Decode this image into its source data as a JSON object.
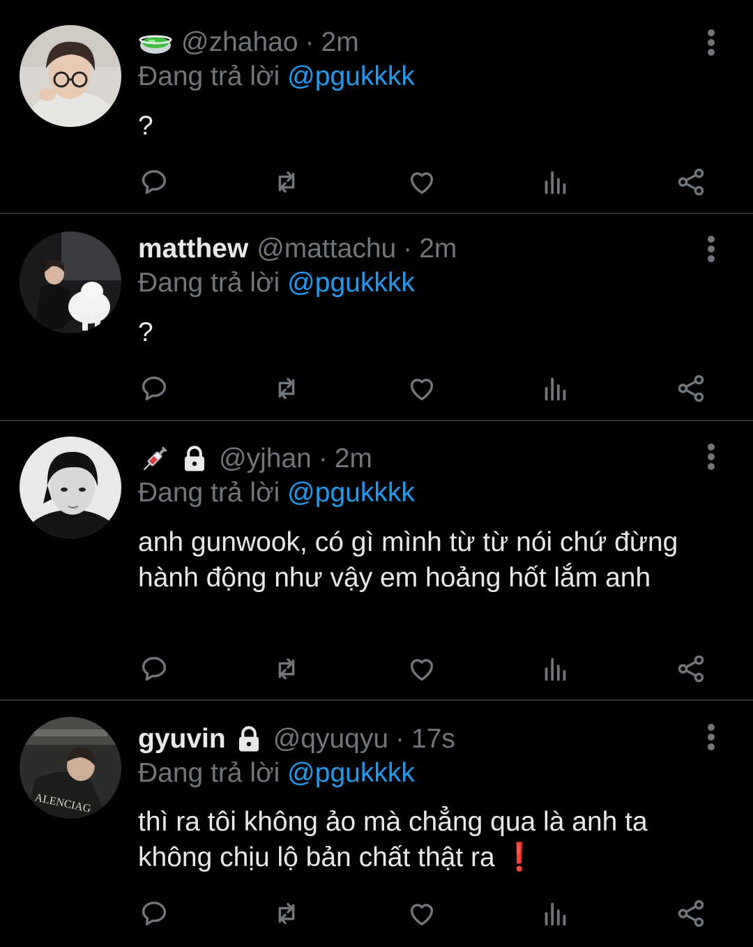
{
  "theme": {
    "background": "#000000",
    "text_primary": "#e7e9ea",
    "text_secondary": "#71767b",
    "accent": "#1d9bf0",
    "divider": "#2f3336"
  },
  "tweets": [
    {
      "display_name": "",
      "name_emoji": "green-bowl-emoji",
      "handle": "@zhahao",
      "separator": "·",
      "time": "2m",
      "reply_prefix": "Đang trả lời",
      "reply_to": "@pgukkkk",
      "text": "?"
    },
    {
      "display_name": "matthew",
      "handle": "@mattachu",
      "separator": "·",
      "time": "2m",
      "reply_prefix": "Đang trả lời",
      "reply_to": "@pgukkkk",
      "text": "?"
    },
    {
      "display_name": "",
      "name_emoji": "syringe-emoji",
      "locked": true,
      "handle": "@yjhan",
      "separator": "·",
      "time": "2m",
      "reply_prefix": "Đang trả lời",
      "reply_to": "@pgukkkk",
      "text": "anh gunwook, có gì mình từ từ nói chứ đừng hành động như vậy em hoảng hốt lắm anh"
    },
    {
      "display_name": "gyuvin",
      "locked": true,
      "handle": "@qyuqyu",
      "separator": "·",
      "time": "17s",
      "reply_prefix": "Đang trả lời",
      "reply_to": "@pgukkkk",
      "text": "thì ra tôi không ảo mà chẳng qua là anh ta không chịu lộ bản chất thật ra",
      "trailing_emoji": "❗"
    }
  ]
}
